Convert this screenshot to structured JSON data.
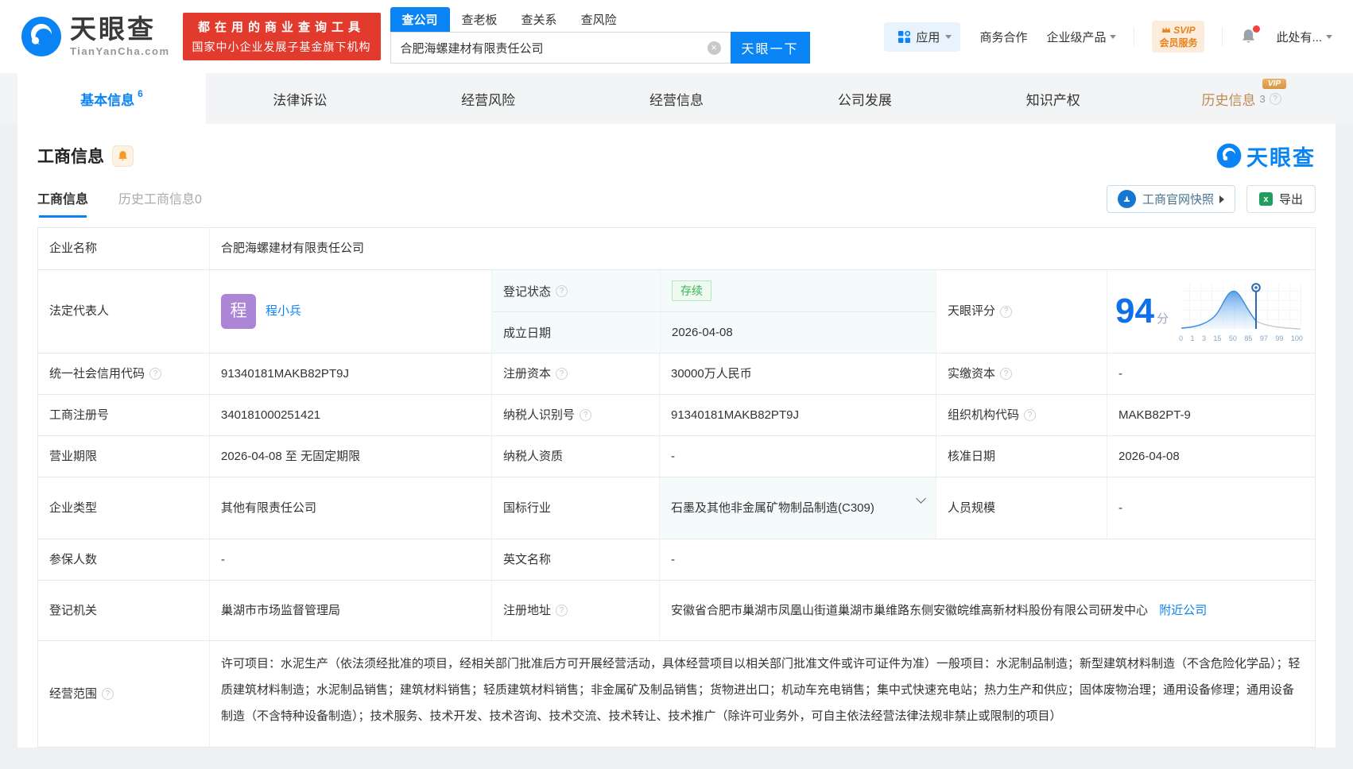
{
  "colors": {
    "brand_blue": "#0a84f4",
    "banner_red": "#e23a2c",
    "vip_orange": "#d69544",
    "status_green": "#3bb353",
    "score_blue": "#1070e8",
    "avatar_purple": "#ac85d7"
  },
  "header": {
    "logo_title": "天眼查",
    "logo_domain": "TianYanCha.com",
    "slogan_line1": "都在用的商业查询工具",
    "slogan_line2": "国家中小企业发展子基金旗下机构",
    "search_tabs": [
      {
        "label": "查公司"
      },
      {
        "label": "查老板"
      },
      {
        "label": "查关系"
      },
      {
        "label": "查风险"
      }
    ],
    "search_value": "合肥海螺建材有限责任公司",
    "search_button": "天眼一下",
    "nav_apps": "应用",
    "nav_cooperation": "商务合作",
    "nav_enterprise": "企业级产品",
    "svip_title": "SVIP",
    "svip_subtitle": "会员服务",
    "nav_user": "此处有..."
  },
  "nav_tabs": [
    {
      "label": "基本信息",
      "count": "6"
    },
    {
      "label": "法律诉讼"
    },
    {
      "label": "经营风险"
    },
    {
      "label": "经营信息"
    },
    {
      "label": "公司发展"
    },
    {
      "label": "知识产权"
    },
    {
      "label": "历史信息",
      "count": "3",
      "vip": "VIP"
    }
  ],
  "section": {
    "title": "工商信息",
    "watermark": "天眼查",
    "subtab_active": "工商信息",
    "subtab_history": "历史工商信息0",
    "snapshot_button": "工商官网快照",
    "export_button": "导出"
  },
  "fields": {
    "company_name": {
      "label": "企业名称",
      "value": "合肥海螺建材有限责任公司"
    },
    "legal_rep": {
      "label": "法定代表人",
      "value": "程小兵",
      "avatar": "程"
    },
    "reg_status": {
      "label": "登记状态",
      "value": "存续"
    },
    "est_date": {
      "label": "成立日期",
      "value": "2026-04-08"
    },
    "score": {
      "label": "天眼评分"
    },
    "credit_code": {
      "label": "统一社会信用代码",
      "value": "91340181MAKB82PT9J"
    },
    "reg_capital": {
      "label": "注册资本",
      "value": "30000万人民币"
    },
    "paid_capital": {
      "label": "实缴资本",
      "value": "-"
    },
    "reg_number": {
      "label": "工商注册号",
      "value": "340181000251421"
    },
    "taxpayer_id": {
      "label": "纳税人识别号",
      "value": "91340181MAKB82PT9J"
    },
    "org_code": {
      "label": "组织机构代码",
      "value": "MAKB82PT-9"
    },
    "business_term": {
      "label": "营业期限",
      "value": "2026-04-08 至 无固定期限"
    },
    "taxpayer_quality": {
      "label": "纳税人资质",
      "value": "-"
    },
    "approval_date": {
      "label": "核准日期",
      "value": "2026-04-08"
    },
    "company_type": {
      "label": "企业类型",
      "value": "其他有限责任公司"
    },
    "industry": {
      "label": "国标行业",
      "value": "石墨及其他非金属矿物制品制造(C309)"
    },
    "staff_size": {
      "label": "人员规模",
      "value": "-"
    },
    "insured_count": {
      "label": "参保人数",
      "value": "-"
    },
    "english_name": {
      "label": "英文名称",
      "value": "-"
    },
    "reg_authority": {
      "label": "登记机关",
      "value": "巢湖市市场监督管理局"
    },
    "reg_address": {
      "label": "注册地址",
      "value": "安徽省合肥市巢湖市凤凰山街道巢湖市巢维路东侧安徽皖维高新材料股份有限公司研发中心",
      "link": "附近公司"
    },
    "business_scope": {
      "label": "经营范围",
      "value": "许可项目：水泥生产（依法须经批准的项目，经相关部门批准后方可开展经营活动，具体经营项目以相关部门批准文件或许可证件为准）一般项目：水泥制品制造；新型建筑材料制造（不含危险化学品）；轻质建筑材料制造；水泥制品销售；建筑材料销售；轻质建筑材料销售；非金属矿及制品销售；货物进出口；机动车充电销售；集中式快速充电站；热力生产和供应；固体废物治理；通用设备修理；通用设备制造（不含特种设备制造）；技术服务、技术开发、技术咨询、技术交流、技术转让、技术推广（除许可业务外，可自主依法经营法律法规非禁止或限制的项目）"
    }
  },
  "score_chart": {
    "type": "area",
    "score": "94",
    "unit": "分",
    "axis_labels": [
      "0",
      "1",
      "3",
      "15",
      "50",
      "85",
      "97",
      "99",
      "100"
    ],
    "marker_value": 94,
    "curve": "percentile bell curve, marker pin at score position"
  }
}
